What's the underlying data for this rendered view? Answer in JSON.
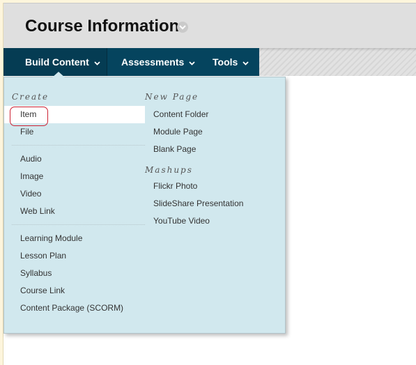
{
  "header": {
    "title": "Course Information"
  },
  "nav": {
    "items": [
      {
        "label": "Build Content"
      },
      {
        "label": "Assessments"
      },
      {
        "label": "Tools"
      }
    ]
  },
  "menu": {
    "create": {
      "heading": "Create",
      "group1": [
        "Item",
        "File"
      ],
      "group2": [
        "Audio",
        "Image",
        "Video",
        "Web Link"
      ],
      "group3": [
        "Learning Module",
        "Lesson Plan",
        "Syllabus",
        "Course Link",
        "Content Package (SCORM)"
      ]
    },
    "new_page": {
      "heading": "New Page",
      "items": [
        "Content Folder",
        "Module Page",
        "Blank Page"
      ]
    },
    "mashups": {
      "heading": "Mashups",
      "items": [
        "Flickr Photo",
        "SlideShare Presentation",
        "YouTube Video"
      ]
    },
    "highlighted_item": "Item"
  },
  "colors": {
    "nav_background": "#05445e",
    "menu_background": "#d1e8ee",
    "highlight_circle": "#cc2233"
  }
}
